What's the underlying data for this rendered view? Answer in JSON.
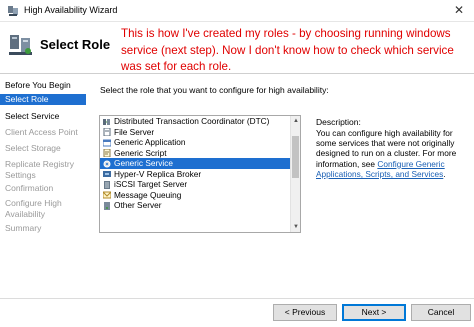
{
  "window": {
    "title": "High Availability Wizard",
    "close_glyph": "✕"
  },
  "header": {
    "title": "Select Role",
    "icon": "cluster-wizard-icon"
  },
  "annotation": {
    "text": "This is how I've created my roles - by choosing running windows service (next step). Now I don't know how to check which service was set for each role.",
    "color": "#e00000"
  },
  "nav": {
    "items": [
      {
        "label": "Before You Begin",
        "state": "done"
      },
      {
        "label": "Select Role",
        "state": "active"
      },
      {
        "label": "Select Service",
        "state": "done"
      },
      {
        "label": "Client Access Point",
        "state": "pending"
      },
      {
        "label": "Select Storage",
        "state": "pending"
      },
      {
        "label": "Replicate Registry Settings",
        "state": "pending"
      },
      {
        "label": "Confirmation",
        "state": "pending"
      },
      {
        "label": "Configure High Availability",
        "state": "pending"
      },
      {
        "label": "Summary",
        "state": "pending"
      }
    ]
  },
  "main": {
    "instruction": "Select the role that you want to configure for high availability:",
    "roles": [
      {
        "label": "Distributed Transaction Coordinator (DTC)",
        "icon": "dtc-icon",
        "selected": false
      },
      {
        "label": "File Server",
        "icon": "file-server-icon",
        "selected": false
      },
      {
        "label": "Generic Application",
        "icon": "application-icon",
        "selected": false
      },
      {
        "label": "Generic Script",
        "icon": "script-icon",
        "selected": false
      },
      {
        "label": "Generic Service",
        "icon": "gear-icon",
        "selected": true
      },
      {
        "label": "Hyper-V Replica Broker",
        "icon": "hyperv-icon",
        "selected": false
      },
      {
        "label": "iSCSI Target Server",
        "icon": "iscsi-icon",
        "selected": false
      },
      {
        "label": "Message Queuing",
        "icon": "message-queue-icon",
        "selected": false
      },
      {
        "label": "Other Server",
        "icon": "server-icon",
        "selected": false
      }
    ],
    "description_label": "Description:",
    "description_text": "You can configure high availability for some services that were not originally designed to run on a cluster. For more information, see ",
    "description_link": "Configure Generic Applications, Scripts, and Services",
    "description_end": "."
  },
  "buttons": {
    "previous": "< Previous",
    "next": "Next >",
    "cancel": "Cancel"
  },
  "colors": {
    "accent": "#1e6fd0",
    "link": "#1a5fb4"
  }
}
